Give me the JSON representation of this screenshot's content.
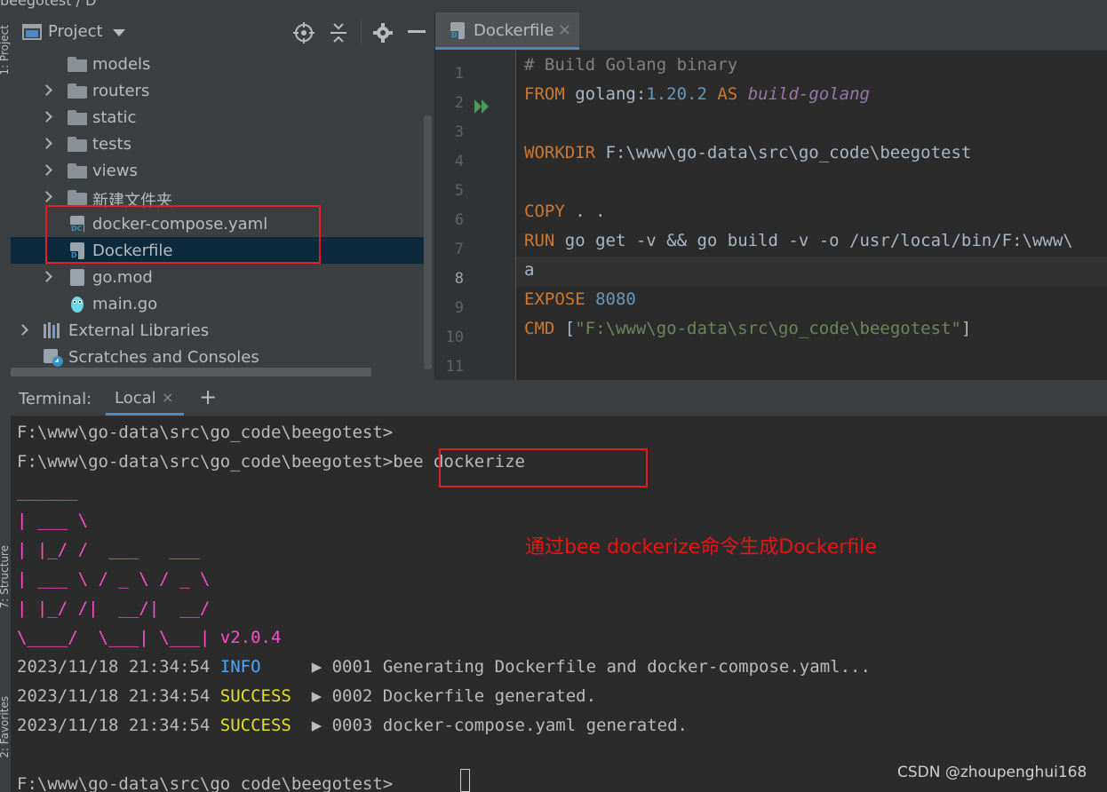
{
  "breadcrumb": {
    "text": "beegotest / D"
  },
  "left_strip": {
    "project_label": "1: Project",
    "structure_label": "7: Structure",
    "favorites_label": "2: Favorites"
  },
  "project_panel": {
    "title": "Project",
    "items": [
      {
        "label": "models",
        "type": "folder",
        "expandable": false
      },
      {
        "label": "routers",
        "type": "folder",
        "expandable": true
      },
      {
        "label": "static",
        "type": "folder",
        "expandable": true
      },
      {
        "label": "tests",
        "type": "folder",
        "expandable": true
      },
      {
        "label": "views",
        "type": "folder",
        "expandable": true
      },
      {
        "label": "新建文件夹",
        "type": "folder",
        "expandable": true
      },
      {
        "label": "docker-compose.yaml",
        "type": "file",
        "icon_tag": "DC"
      },
      {
        "label": "Dockerfile",
        "type": "file",
        "icon_tag": "D",
        "selected": true
      },
      {
        "label": "go.mod",
        "type": "file",
        "expandable": true
      },
      {
        "label": "main.go",
        "type": "gofile"
      },
      {
        "label": "External Libraries",
        "type": "libraries",
        "expandable": true
      },
      {
        "label": "Scratches and Consoles",
        "type": "scratches"
      }
    ]
  },
  "editor": {
    "tab": {
      "label": "Dockerfile",
      "icon_tag": "D"
    },
    "line_numbers": [
      "1",
      "2",
      "3",
      "4",
      "5",
      "6",
      "7",
      "8",
      "9",
      "10",
      "11"
    ],
    "code": {
      "l1_comment": "# Build Golang binary",
      "l2_from": "FROM",
      "l2_image": " golang:",
      "l2_version": "1.20.2",
      "l2_as": " AS ",
      "l2_stage": "build-golang",
      "l4_kw": "WORKDIR",
      "l4_path": " F:\\www\\go-data\\src\\go_code\\beegotest",
      "l6_kw": "COPY",
      "l6_rest": " . .",
      "l7_kw": "RUN",
      "l7_rest": " go get -v && go build -v -o /usr/local/bin/F:\\www\\",
      "l8_rest": "a",
      "l9_kw": "EXPOSE",
      "l9_port": " 8080",
      "l10_kw": "CMD",
      "l10_open": " [",
      "l10_str": "\"F:\\www\\go-data\\src\\go_code\\beegotest\"",
      "l10_close": "]"
    }
  },
  "terminal": {
    "title": "Terminal:",
    "tab_label": "Local",
    "lines": {
      "prompt1": "F:\\www\\go-data\\src\\go_code\\beegotest>",
      "prompt2": "F:\\www\\go-data\\src\\go_code\\beegotest>bee dockerize",
      "art1": "______",
      "art2": "| ___ \\",
      "art3": "| |_/ /  ___   ___",
      "art4": "| ___ \\ / _ \\ / _ \\",
      "art5": "| |_/ /|  __/|  __/",
      "art6": "\\____/  \\___| \\___| ",
      "version": "v2.0.4",
      "log1_time": "2023/11/18 21:34:54 ",
      "log1_level": "INFO",
      "log1_msg": "     ▶ 0001 Generating Dockerfile and docker-compose.yaml...",
      "log2_time": "2023/11/18 21:34:54 ",
      "log2_level": "SUCCESS",
      "log2_msg": "  ▶ 0002 Dockerfile generated.",
      "log3_time": "2023/11/18 21:34:54 ",
      "log3_level": "SUCCESS",
      "log3_msg": "  ▶ 0003 docker-compose.yaml generated.",
      "prompt3": "F:\\www\\go-data\\src\\go_code\\beegotest>"
    }
  },
  "annotation": "通过bee dockerize命令生成Dockerfile",
  "watermark": "CSDN @zhoupenghui168",
  "colors": {
    "accent_blue": "#4a88c7",
    "annotation_red": "#e02020",
    "ascii_pink": "#ff4dcc",
    "info_blue": "#4aa9ff",
    "success_yellow": "#e1e127"
  }
}
